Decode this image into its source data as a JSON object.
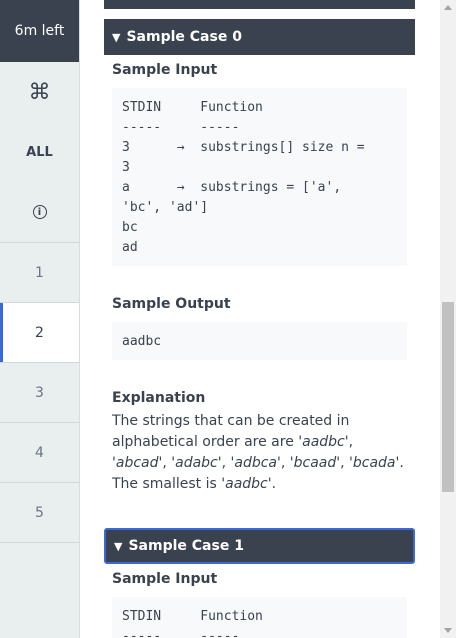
{
  "sidebar": {
    "timer": "6m left",
    "cmd_glyph": "⌘",
    "all_label": "ALL",
    "info_glyph": "i",
    "questions": [
      "1",
      "2",
      "3",
      "4",
      "5"
    ],
    "active_question": "2"
  },
  "case0": {
    "title": "Sample Case 0",
    "input_label": "Sample Input",
    "input_lines": [
      "STDIN     Function",
      "-----     -----",
      "3      →  substrings[] size n =",
      "3",
      "a      →  substrings = ['a',",
      "'bc', 'ad']",
      "bc",
      "ad"
    ],
    "output_label": "Sample Output",
    "output_value": "aadbc",
    "explanation_label": "Explanation",
    "explanation": {
      "p1": "The strings that can be created in alphabetical order are are '",
      "s1": "aadbc",
      "p2": "', '",
      "s2": "abcad",
      "p3": "', '",
      "s3": "adabc",
      "p4": "', '",
      "s4": "adbca",
      "p5": "', '",
      "s5": "bcaad",
      "p6": "', '",
      "s6": "bcada",
      "p7": "'. The smallest is '",
      "s7": "aadbc",
      "p8": "'."
    }
  },
  "case1": {
    "title": "Sample Case 1",
    "input_label": "Sample Input",
    "input_lines": [
      "STDIN     Function",
      "-----     -----"
    ]
  },
  "colors": {
    "header_bg": "#39424e",
    "accent": "#3b6ad8",
    "sidebar_bg": "#e9eeef",
    "code_bg": "#f8f9fb"
  },
  "icons": {
    "command": "command-icon",
    "info": "info-icon",
    "collapse": "triangle-down-icon"
  }
}
